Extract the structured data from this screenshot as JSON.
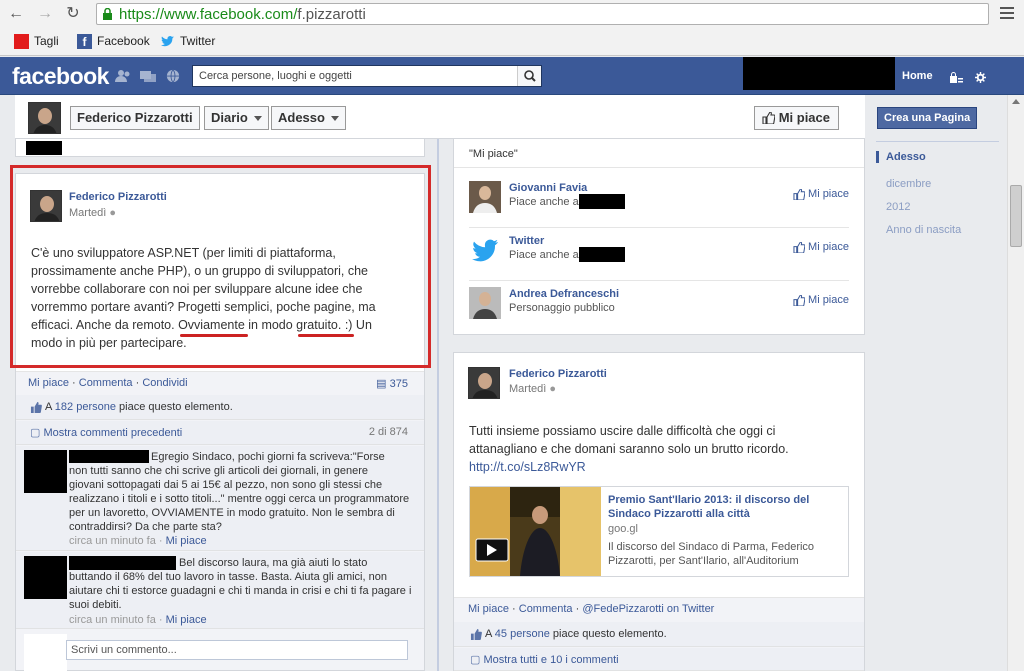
{
  "browser": {
    "url_host": "https://www.facebook.com/",
    "url_path": "f.pizzarotti",
    "bookmarks": [
      {
        "label": "Tagli",
        "icon": "red-square-icon",
        "color": "#e21b1b"
      },
      {
        "label": "Facebook",
        "icon": "facebook-icon",
        "color": "#3b5998"
      },
      {
        "label": "Twitter",
        "icon": "twitter-bird-icon",
        "color": "#2aa3ef"
      }
    ]
  },
  "fbbar": {
    "logo": "facebook",
    "search_placeholder": "Cerca persone, luoghi e oggetti",
    "home_label": "Home"
  },
  "profile_header": {
    "name": "Federico Pizzarotti",
    "diario": "Diario",
    "adesso": "Adesso",
    "like_label": "Mi piace"
  },
  "sidebar": {
    "create_page": "Crea una Pagina",
    "scrubber": [
      "Adesso",
      "dicembre",
      "2012",
      "Anno di nascita"
    ]
  },
  "post1": {
    "author": "Federico Pizzarotti",
    "time": "Martedì",
    "text_lines": [
      "C'è uno sviluppatore ASP.NET (per limiti di piattaforma,",
      "prossimamente anche PHP), o un gruppo di sviluppatori, che",
      "vorrebbe collaborare con noi per sviluppare alcune idee che",
      "vorremmo portare avanti? Progetti semplici, poche pagine, ma",
      "efficaci. Anche da remoto. Ovviamente in modo gratuito. :) Un",
      "modo in più per partecipare."
    ],
    "actions": {
      "like": "Mi piace",
      "comment": "Commenta",
      "share": "Condividi",
      "share_count": "375"
    },
    "likes_prefix": "A ",
    "likes_link": "182 persone",
    "likes_suffix": " piace questo elemento.",
    "prev_comments": "Mostra commenti precedenti",
    "comment_count": "2 di 874",
    "comments": [
      {
        "lines": [
          "Egregio Sindaco, pochi giorni fa scriveva:\"Forse",
          "non tutti sanno che chi scrive gli articoli dei giornali, in genere",
          "giovani sottopagati dai 5 ai 15€ al pezzo, non sono gli stessi che",
          "realizzano i titoli e i sotto titoli...\" mentre oggi cerca un programmatore",
          "per un lavoretto, OVVIAMENTE in modo gratuito. Non le sembra di",
          "contraddirsi? Da che parte sta?"
        ],
        "time": "circa un minuto fa",
        "like": "Mi piace"
      },
      {
        "lines": [
          "Bel discorso laura, ma già aiuti lo stato",
          "buttando il 68% del tuo lavoro in tasse. Basta. Aiuta gli amici, non",
          "aiutare chi ti estorce guadagni e chi ti manda in crisi e chi ti fa pagare i",
          "suoi debiti."
        ],
        "time": "circa un minuto fa",
        "like": "Mi piace"
      }
    ],
    "comment_placeholder": "Scrivi un commento..."
  },
  "likes_box": {
    "header": "\"Mi piace\"",
    "rows": [
      {
        "name": "Giovanni Favia",
        "sub": "Piace anche a",
        "like": "Mi piace",
        "redacted": true
      },
      {
        "name": "Twitter",
        "sub": "Piace anche a",
        "like": "Mi piace",
        "redacted": true
      },
      {
        "name": "Andrea Defranceschi",
        "sub": "Personaggio pubblico",
        "like": "Mi piace",
        "redacted": false
      }
    ]
  },
  "post2": {
    "author": "Federico Pizzarotti",
    "time": "Martedì",
    "text_lines": [
      "Tutti insieme possiamo uscire dalle difficoltà che oggi ci",
      "attanagliano e che domani saranno solo un brutto ricordo."
    ],
    "link": "http://t.co/sLz8RwYR",
    "attachment": {
      "title": "Premio Sant'Ilario 2013: il discorso del Sindaco Pizzarotti alla città",
      "domain": "goo.gl",
      "desc": "Il discorso del Sindaco di Parma, Federico Pizzarotti, per Sant'Ilario, all'Auditorium"
    },
    "actions": {
      "like": "Mi piace",
      "comment": "Commenta",
      "via": "@FedePizzarotti on Twitter"
    },
    "likes_prefix": "A ",
    "likes_link": "45 persone",
    "likes_suffix": " piace questo elemento.",
    "show_comments": "Mostra tutti e 10 i commenti"
  }
}
